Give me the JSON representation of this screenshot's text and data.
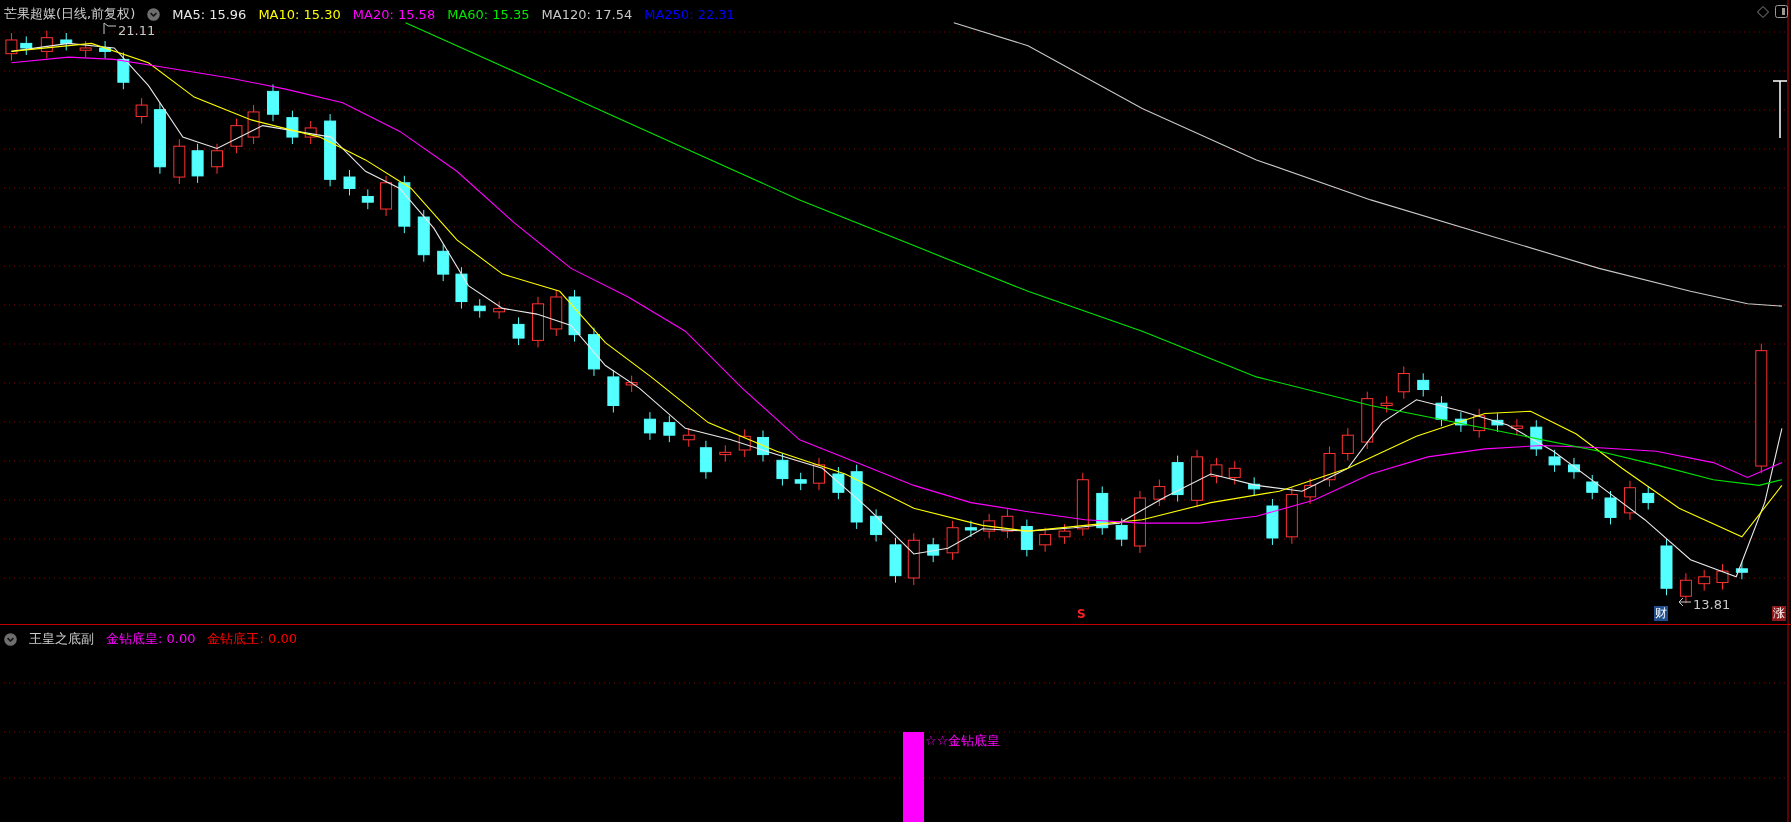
{
  "main_panel": {
    "title": "芒果超媒(日线,前复权)",
    "indicators": [
      {
        "label": "MA5: 15.96",
        "color": "#e8e8e8"
      },
      {
        "label": "MA10: 15.30",
        "color": "#ffff00"
      },
      {
        "label": "MA20: 15.58",
        "color": "#ff00ff"
      },
      {
        "label": "MA60: 15.35",
        "color": "#00e600"
      },
      {
        "label": "MA120: 17.54",
        "color": "#c8c8c8"
      },
      {
        "label": "MA250: 22.31",
        "color": "#0000ff"
      }
    ],
    "high_label": "21.11",
    "low_label": "13.81",
    "signal_marker": "S",
    "event_badges": [
      {
        "text": "财",
        "color": "#1f4f8f"
      },
      {
        "text": "涨",
        "color": "#8b1a1a"
      }
    ]
  },
  "sub_panel": {
    "title": "王皇之底副",
    "indicators": [
      {
        "label": "金钻底皇: 0.00",
        "color": "#ff00ff"
      },
      {
        "label": "金钻底王: 0.00",
        "color": "#ff0000"
      }
    ],
    "signal_label": "☆☆金钻底皇"
  }
}
